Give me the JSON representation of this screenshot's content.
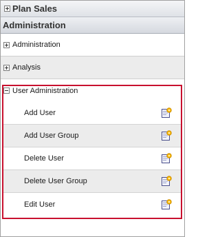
{
  "panel": {
    "plan_sales_label": "Plan Sales",
    "section_title": "Administration"
  },
  "tree": {
    "administration_label": "Administration",
    "analysis_label": "Analysis",
    "user_administration_label": "User Administration",
    "user_admin_items": [
      {
        "label": "Add User",
        "icon": "edit-page-icon"
      },
      {
        "label": "Add User Group",
        "icon": "edit-page-icon"
      },
      {
        "label": "Delete User",
        "icon": "edit-page-icon"
      },
      {
        "label": "Delete User Group",
        "icon": "edit-page-icon"
      },
      {
        "label": "Edit User",
        "icon": "edit-page-icon"
      }
    ]
  },
  "colors": {
    "highlight_border": "#c8102e",
    "row_alt_background": "#ececec"
  }
}
